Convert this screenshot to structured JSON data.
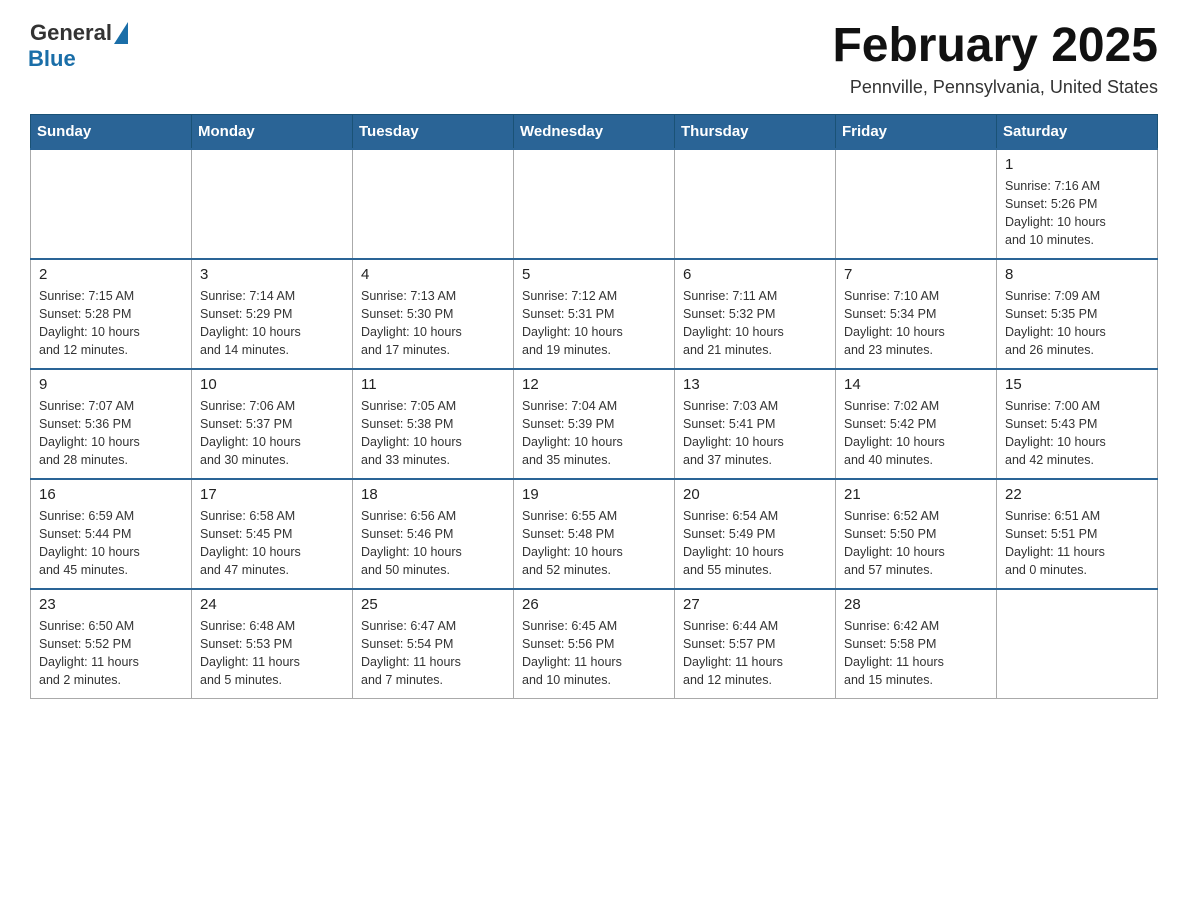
{
  "header": {
    "logo_general": "General",
    "logo_blue": "Blue",
    "month_title": "February 2025",
    "location": "Pennville, Pennsylvania, United States"
  },
  "weekdays": [
    "Sunday",
    "Monday",
    "Tuesday",
    "Wednesday",
    "Thursday",
    "Friday",
    "Saturday"
  ],
  "weeks": [
    [
      {
        "day": "",
        "info": ""
      },
      {
        "day": "",
        "info": ""
      },
      {
        "day": "",
        "info": ""
      },
      {
        "day": "",
        "info": ""
      },
      {
        "day": "",
        "info": ""
      },
      {
        "day": "",
        "info": ""
      },
      {
        "day": "1",
        "info": "Sunrise: 7:16 AM\nSunset: 5:26 PM\nDaylight: 10 hours\nand 10 minutes."
      }
    ],
    [
      {
        "day": "2",
        "info": "Sunrise: 7:15 AM\nSunset: 5:28 PM\nDaylight: 10 hours\nand 12 minutes."
      },
      {
        "day": "3",
        "info": "Sunrise: 7:14 AM\nSunset: 5:29 PM\nDaylight: 10 hours\nand 14 minutes."
      },
      {
        "day": "4",
        "info": "Sunrise: 7:13 AM\nSunset: 5:30 PM\nDaylight: 10 hours\nand 17 minutes."
      },
      {
        "day": "5",
        "info": "Sunrise: 7:12 AM\nSunset: 5:31 PM\nDaylight: 10 hours\nand 19 minutes."
      },
      {
        "day": "6",
        "info": "Sunrise: 7:11 AM\nSunset: 5:32 PM\nDaylight: 10 hours\nand 21 minutes."
      },
      {
        "day": "7",
        "info": "Sunrise: 7:10 AM\nSunset: 5:34 PM\nDaylight: 10 hours\nand 23 minutes."
      },
      {
        "day": "8",
        "info": "Sunrise: 7:09 AM\nSunset: 5:35 PM\nDaylight: 10 hours\nand 26 minutes."
      }
    ],
    [
      {
        "day": "9",
        "info": "Sunrise: 7:07 AM\nSunset: 5:36 PM\nDaylight: 10 hours\nand 28 minutes."
      },
      {
        "day": "10",
        "info": "Sunrise: 7:06 AM\nSunset: 5:37 PM\nDaylight: 10 hours\nand 30 minutes."
      },
      {
        "day": "11",
        "info": "Sunrise: 7:05 AM\nSunset: 5:38 PM\nDaylight: 10 hours\nand 33 minutes."
      },
      {
        "day": "12",
        "info": "Sunrise: 7:04 AM\nSunset: 5:39 PM\nDaylight: 10 hours\nand 35 minutes."
      },
      {
        "day": "13",
        "info": "Sunrise: 7:03 AM\nSunset: 5:41 PM\nDaylight: 10 hours\nand 37 minutes."
      },
      {
        "day": "14",
        "info": "Sunrise: 7:02 AM\nSunset: 5:42 PM\nDaylight: 10 hours\nand 40 minutes."
      },
      {
        "day": "15",
        "info": "Sunrise: 7:00 AM\nSunset: 5:43 PM\nDaylight: 10 hours\nand 42 minutes."
      }
    ],
    [
      {
        "day": "16",
        "info": "Sunrise: 6:59 AM\nSunset: 5:44 PM\nDaylight: 10 hours\nand 45 minutes."
      },
      {
        "day": "17",
        "info": "Sunrise: 6:58 AM\nSunset: 5:45 PM\nDaylight: 10 hours\nand 47 minutes."
      },
      {
        "day": "18",
        "info": "Sunrise: 6:56 AM\nSunset: 5:46 PM\nDaylight: 10 hours\nand 50 minutes."
      },
      {
        "day": "19",
        "info": "Sunrise: 6:55 AM\nSunset: 5:48 PM\nDaylight: 10 hours\nand 52 minutes."
      },
      {
        "day": "20",
        "info": "Sunrise: 6:54 AM\nSunset: 5:49 PM\nDaylight: 10 hours\nand 55 minutes."
      },
      {
        "day": "21",
        "info": "Sunrise: 6:52 AM\nSunset: 5:50 PM\nDaylight: 10 hours\nand 57 minutes."
      },
      {
        "day": "22",
        "info": "Sunrise: 6:51 AM\nSunset: 5:51 PM\nDaylight: 11 hours\nand 0 minutes."
      }
    ],
    [
      {
        "day": "23",
        "info": "Sunrise: 6:50 AM\nSunset: 5:52 PM\nDaylight: 11 hours\nand 2 minutes."
      },
      {
        "day": "24",
        "info": "Sunrise: 6:48 AM\nSunset: 5:53 PM\nDaylight: 11 hours\nand 5 minutes."
      },
      {
        "day": "25",
        "info": "Sunrise: 6:47 AM\nSunset: 5:54 PM\nDaylight: 11 hours\nand 7 minutes."
      },
      {
        "day": "26",
        "info": "Sunrise: 6:45 AM\nSunset: 5:56 PM\nDaylight: 11 hours\nand 10 minutes."
      },
      {
        "day": "27",
        "info": "Sunrise: 6:44 AM\nSunset: 5:57 PM\nDaylight: 11 hours\nand 12 minutes."
      },
      {
        "day": "28",
        "info": "Sunrise: 6:42 AM\nSunset: 5:58 PM\nDaylight: 11 hours\nand 15 minutes."
      },
      {
        "day": "",
        "info": ""
      }
    ]
  ]
}
